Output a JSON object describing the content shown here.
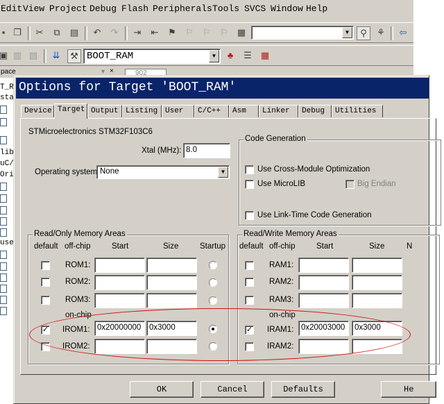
{
  "menu": [
    "Edit",
    "View",
    "Project",
    "Debug",
    "Flash",
    "Peripherals",
    "Tools",
    "SVCS",
    "Window",
    "Help"
  ],
  "toolbar": {
    "target_select": "BOOT_RAM",
    "search_value": ""
  },
  "project_pane": {
    "header": "pace",
    "items": [
      "T_R",
      "sta",
      "",
      "",
      "",
      "lib",
      "uC/",
      "Ori",
      "",
      "",
      "",
      "",
      "",
      "use",
      "",
      "",
      "",
      "",
      "",
      ""
    ],
    "tab": "902"
  },
  "dialog": {
    "title": "Options for Target 'BOOT_RAM'",
    "tabs": [
      "Device",
      "Target",
      "Output",
      "Listing",
      "User",
      "C/C++",
      "Asm",
      "Linker",
      "Debug",
      "Utilities"
    ],
    "active_tab": "Target",
    "device": "STMicroelectronics STM32F103C6",
    "xtal_label": "Xtal (MHz):",
    "xtal_value": "8.0",
    "os_label": "Operating system:",
    "os_value": "None",
    "code_gen": {
      "title": "Code Generation",
      "cross_module": "Use Cross-Module Optimization",
      "microlib": "Use MicroLIB",
      "big_endian": "Big Endian",
      "ltcg": "Use Link-Time Code Generation"
    },
    "ro_memory": {
      "title": "Read/Only Memory Areas",
      "headers": {
        "default": "default",
        "offchip": "off-chip",
        "start": "Start",
        "size": "Size",
        "startup": "Startup"
      },
      "on_chip_label": "on-chip",
      "rows": [
        {
          "name": "ROM1:",
          "start": "",
          "size": "",
          "default": false,
          "startup": false
        },
        {
          "name": "ROM2:",
          "start": "",
          "size": "",
          "default": false,
          "startup": false
        },
        {
          "name": "ROM3:",
          "start": "",
          "size": "",
          "default": false,
          "startup": false
        },
        {
          "name": "IROM1:",
          "start": "0x20000000",
          "size": "0x3000",
          "default": true,
          "startup": true
        },
        {
          "name": "IROM2:",
          "start": "",
          "size": "",
          "default": false,
          "startup": false
        }
      ]
    },
    "rw_memory": {
      "title": "Read/Write Memory Areas",
      "headers": {
        "default": "default",
        "offchip": "off-chip",
        "start": "Start",
        "size": "Size",
        "noinit": "N"
      },
      "on_chip_label": "on-chip",
      "rows": [
        {
          "name": "RAM1:",
          "start": "",
          "size": "",
          "default": false
        },
        {
          "name": "RAM2:",
          "start": "",
          "size": "",
          "default": false
        },
        {
          "name": "RAM3:",
          "start": "",
          "size": "",
          "default": false
        },
        {
          "name": "IRAM1:",
          "start": "0x20003000",
          "size": "0x3000",
          "default": true
        },
        {
          "name": "IRAM2:",
          "start": "",
          "size": "",
          "default": false
        }
      ]
    },
    "buttons": {
      "ok": "OK",
      "cancel": "Cancel",
      "defaults": "Defaults",
      "help": "He"
    }
  },
  "colors": {
    "title_bar": "#0a246a",
    "face": "#d4d0c8",
    "annotation": "#d01010"
  }
}
